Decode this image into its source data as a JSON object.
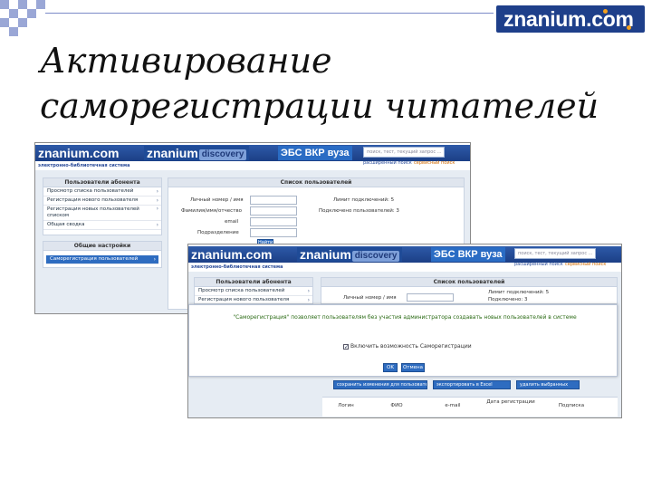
{
  "slide": {
    "title_line1": "Активирование",
    "title_line2": "саморегистрации читателей",
    "logo": "znanium.com",
    "logo_accent": "#f4a11d",
    "logo_bg": "#1e3f8a"
  },
  "screenshot_back": {
    "brand1": "znanium.com",
    "brand2": "znanium",
    "brand2_badge": "discovery",
    "brand3": "ЭБС ВКР вуза",
    "search_placeholder": "поиск, тест, текущий запрос ...",
    "extended_search": "расширенный поиск",
    "help_link": "сервисный поиск",
    "tagline": "электронно-библиотечная система",
    "account_panel_title": "Пользователи абонента",
    "menu": [
      "Просмотр списка пользователей",
      "Регистрация нового пользователя",
      "Регистрация новых пользователей списком",
      "Общая сводка"
    ],
    "settings_title": "Общие настройки",
    "settings_active": "Саморегистрация пользователей",
    "list_title": "Список пользователей",
    "fields": [
      "Личный номер / имя",
      "Фамилия/имя/отчество",
      "email",
      "Подразделение"
    ],
    "stat1": "Лимит подключений: 5",
    "stat2": "Подключено пользователей: 3",
    "find_button": "Найти"
  },
  "screenshot_front": {
    "brand1": "znanium.com",
    "brand2": "znanium",
    "brand2_badge": "discovery",
    "brand3": "ЭБС ВКР вуза",
    "search_placeholder": "поиск, тест, текущий запрос ...",
    "extended_search": "расширенный поиск",
    "help_link": "сервисный поиск",
    "tagline": "электронно-библиотечная система",
    "account_panel_title": "Пользователи абонента",
    "menu": [
      "Просмотр списка пользователей",
      "Регистрация нового пользователя"
    ],
    "list_title": "Список пользователей",
    "field1": "Личный номер / имя",
    "stat1": "Лимит подключений: 5",
    "stat2": "Подключено: 3",
    "modal_message": "\"Саморегистрация\" позволяет пользователям без участия администратора создавать новых пользователей в системе",
    "modal_checkbox": "Включить возможность Саморегистрации",
    "ok_button": "OK",
    "cancel_button": "Отмена",
    "action_left": "сохранить изменения для пользователей",
    "action_mid": "экспортировать в Excel",
    "action_right": "удалить выбранных",
    "table_headers": [
      "Логин",
      "ФИО",
      "e-mail",
      "Дата регистрации",
      "Подписка"
    ]
  }
}
